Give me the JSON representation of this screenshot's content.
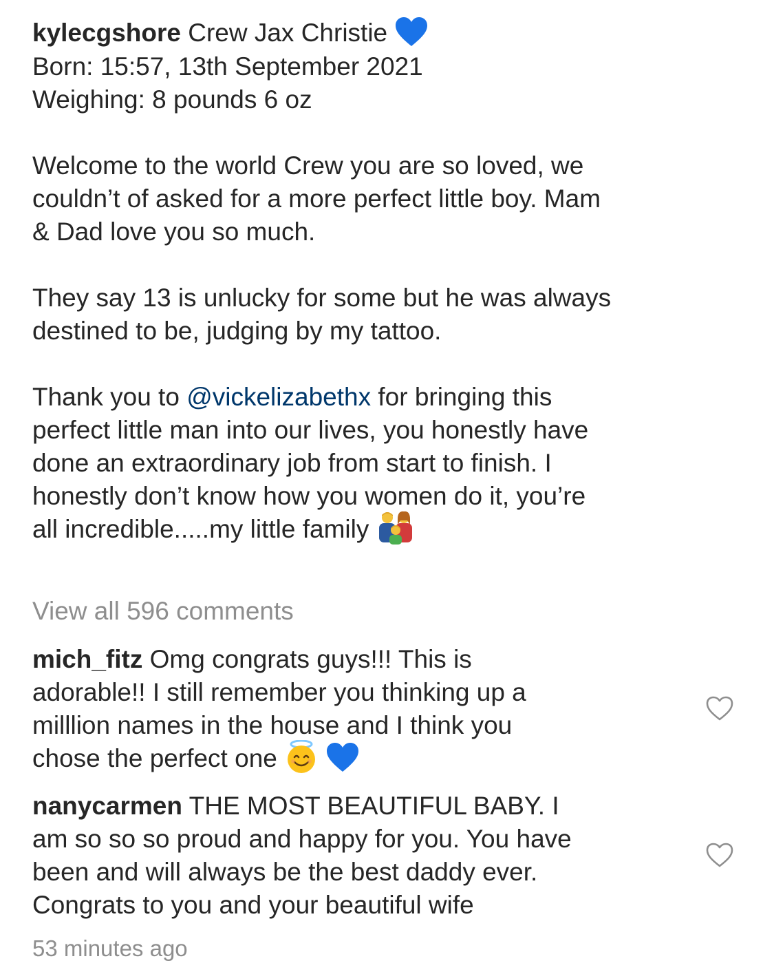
{
  "post": {
    "username": "kylecgshore",
    "caption_lines": {
      "l1": "Crew Jax Christie",
      "l2": "Born: 15:57, 13th September 2021",
      "l3": "Weighing: 8 pounds 6 oz",
      "p2_1": "Welcome to the world Crew you are so loved, we",
      "p2_2": "couldn’t of asked for a more perfect little boy. Mam",
      "p2_3": "& Dad love you so much.",
      "p3_1": "They say 13 is unlucky for some but he was always",
      "p3_2": "destined to be, judging by my tattoo.",
      "p4_1a": "Thank you to ",
      "p4_mention": "@vickelizabethx",
      "p4_1b": " for bringing this",
      "p4_2": "perfect little man into our lives, you honestly have",
      "p4_3": "done an extraordinary job from start to finish. I",
      "p4_4": "honestly don’t know how you women do it, you’re",
      "p4_5": "all incredible.....my little family"
    },
    "emojis": {
      "caption_heart": "blue-heart-icon",
      "family": "family-man-woman-boy-icon"
    }
  },
  "comments_link": "View all 596 comments",
  "comments": [
    {
      "username": "mich_fitz",
      "lines": [
        "Omg congrats guys!!! This is",
        "adorable!! I still remember you thinking up a",
        "milllion names in the house and I think you",
        "chose the perfect one"
      ],
      "emojis": [
        "smiling-face-with-halo-icon",
        "blue-heart-icon"
      ]
    },
    {
      "username": "nanycarmen",
      "lines": [
        "THE MOST BEAUTIFUL BABY. I",
        "am so so so proud and happy for you. You have",
        "been and will always be the best daddy ever.",
        "Congrats to you and your beautiful wife"
      ]
    }
  ],
  "timestamp": "53 minutes ago",
  "colors": {
    "text": "#262626",
    "muted": "#8e8e8e",
    "mention": "#00376b",
    "blue_heart": "#1a73e8"
  }
}
